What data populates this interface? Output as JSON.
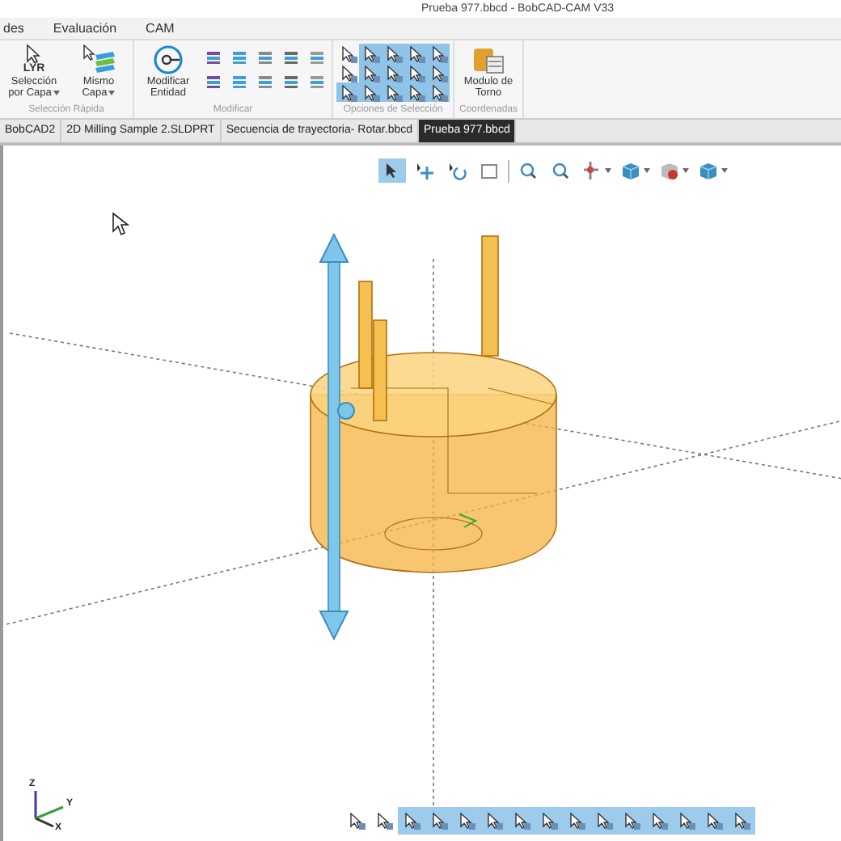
{
  "window": {
    "title": "Prueba 977.bbcd - BobCAD-CAM V33"
  },
  "menu": [
    {
      "label": "des"
    },
    {
      "label": "Evaluación"
    },
    {
      "label": "CAM"
    }
  ],
  "ribbon": {
    "groups": [
      {
        "kind": "quick",
        "label": "Selección Rápida",
        "buttons": [
          {
            "label": "Selección por Capa",
            "badge": "LYR",
            "dropdown": true
          },
          {
            "label": "Mismo Capa",
            "dropdown": true
          }
        ]
      },
      {
        "kind": "modify",
        "label": "Modificar",
        "buttons": [
          {
            "label": "Modificar Entidad",
            "dropdown": false
          }
        ]
      },
      {
        "kind": "options",
        "label": "Opciones de Selección",
        "toggles": [
          {
            "selected": false
          },
          {
            "selected": true
          },
          {
            "selected": true
          },
          {
            "selected": true
          },
          {
            "selected": true
          },
          {
            "selected": false
          },
          {
            "selected": true
          },
          {
            "selected": true
          },
          {
            "selected": true
          },
          {
            "selected": true
          },
          {
            "selected": true
          },
          {
            "selected": true
          },
          {
            "selected": true
          },
          {
            "selected": true
          },
          {
            "selected": true
          }
        ]
      },
      {
        "kind": "coords",
        "label": "Coordenadas",
        "buttons": [
          {
            "label": "Modulo de Torno",
            "dropdown": false
          }
        ]
      }
    ]
  },
  "tabs": [
    {
      "label": "BobCAD2",
      "selected": false
    },
    {
      "label": "2D Milling Sample 2.SLDPRT",
      "selected": false
    },
    {
      "label": "Secuencia de trayectoria- Rotar.bbcd",
      "selected": false
    },
    {
      "label": "Prueba 977.bbcd",
      "selected": true
    }
  ],
  "view_toolbar": [
    {
      "kind": "select",
      "selected": true,
      "dropdown": false
    },
    {
      "kind": "move",
      "selected": false,
      "dropdown": false
    },
    {
      "kind": "rotate",
      "selected": false,
      "dropdown": false
    },
    {
      "kind": "window",
      "selected": false,
      "dropdown": false
    },
    {
      "kind": "zoom",
      "selected": false,
      "dropdown": false
    },
    {
      "kind": "zoom",
      "selected": false,
      "dropdown": false
    },
    {
      "kind": "pan",
      "selected": false,
      "dropdown": true
    },
    {
      "kind": "cube",
      "selected": false,
      "dropdown": true
    },
    {
      "kind": "shade",
      "selected": false,
      "dropdown": true
    },
    {
      "kind": "cube",
      "selected": false,
      "dropdown": true
    }
  ],
  "filter_toolbar": [
    {
      "selected": false
    },
    {
      "selected": false
    },
    {
      "selected": true
    },
    {
      "selected": true
    },
    {
      "selected": true
    },
    {
      "selected": true
    },
    {
      "selected": true
    },
    {
      "selected": true
    },
    {
      "selected": true
    },
    {
      "selected": true
    },
    {
      "selected": true
    },
    {
      "selected": true
    },
    {
      "selected": true
    },
    {
      "selected": true
    },
    {
      "selected": true
    }
  ],
  "triad": {
    "x": "X",
    "y": "Y",
    "z": "Z"
  }
}
